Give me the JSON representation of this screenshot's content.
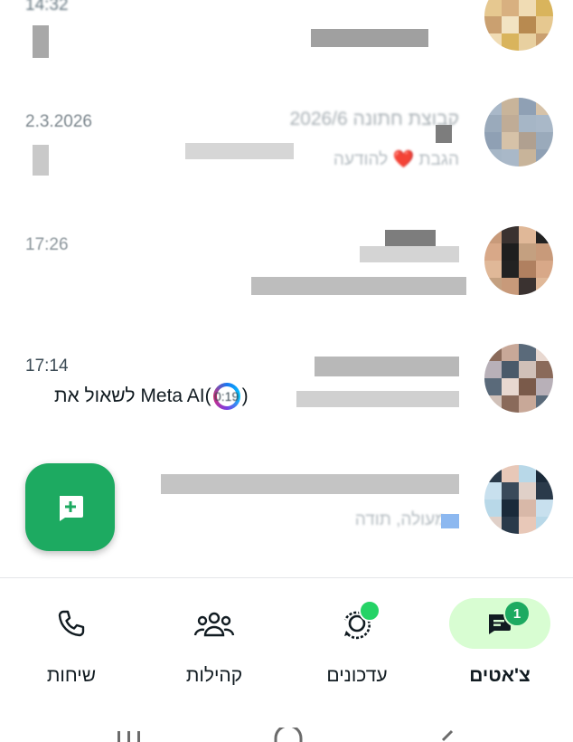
{
  "chats": [
    {
      "time": "14:32",
      "name": "",
      "preview": "",
      "colors": [
        "#d9b45c",
        "#e8d0a0",
        "#caa070",
        "#f2e3c2",
        "#b88a50",
        "#e6c890",
        "#d8b080",
        "#f0dcb4"
      ]
    },
    {
      "time": "2.3.2026",
      "name": "קבוצת חתונה 2026/6",
      "preview": "הגבת ❤️ להודעה",
      "colors": [
        "#a9b8c8",
        "#c8b49a",
        "#8fa0b4",
        "#d6c2a8",
        "#b0a090",
        "#9aaabb",
        "#c0ac96",
        "#a6b6c6"
      ]
    },
    {
      "time": "17:26",
      "name": "",
      "preview": "",
      "colors": [
        "#c89a7a",
        "#3a3230",
        "#e0b898",
        "#222",
        "#b08060",
        "#d8a888",
        "#1e1e1e",
        "#c4a080"
      ]
    },
    {
      "time": "17:14",
      "name": "",
      "preview": "",
      "colors": [
        "#8a6a5a",
        "#c8a898",
        "#5a6a7a",
        "#e8d8d0",
        "#7a5a4a",
        "#b8b0b8",
        "#4a5a6a",
        "#d0c0b8"
      ]
    },
    {
      "time": "",
      "name": "",
      "preview": "מעולה, תודה",
      "colors": [
        "#2a3a4a",
        "#e8c8b8",
        "#b8d8e8",
        "#1a2a3a",
        "#d8b8a8",
        "#c8e0ee",
        "#3a4a5a",
        "#e0d0c8"
      ]
    }
  ],
  "meta_ai": {
    "text": "לשאול את Meta AI",
    "paren_open": "(",
    "paren_close": ")",
    "duration": "0:19"
  },
  "fab": {
    "label": "new-chat"
  },
  "nav": {
    "chats": {
      "label": "צ'אטים",
      "badge": "1"
    },
    "updates": {
      "label": "עדכונים"
    },
    "communities": {
      "label": "קהילות"
    },
    "calls": {
      "label": "שיחות"
    }
  },
  "colors": {
    "accent": "#1daa61",
    "active_bg": "#d8fdd2",
    "status_dot": "#25d366"
  }
}
